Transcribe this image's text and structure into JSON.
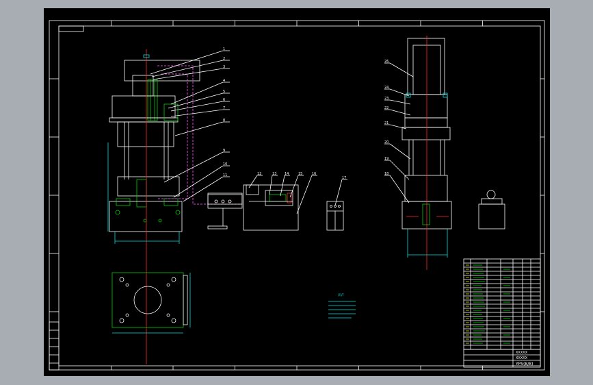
{
  "drawing": {
    "title_block": {
      "row_a": "XXXXX",
      "row_b": "XXXXX",
      "row_c": "YPS(8/8)"
    },
    "press_front_labels": [
      "1",
      "2",
      "3",
      "4",
      "5",
      "6",
      "7",
      "8",
      "9",
      "10",
      "11"
    ],
    "unit_labels": [
      "12",
      "13",
      "14",
      "15",
      "16",
      "17"
    ],
    "press_side_labels": [
      "26",
      "24",
      "23",
      "22",
      "21",
      "20",
      "19",
      "18"
    ],
    "tech_note_title": "/////",
    "colors": {
      "background": "#000000",
      "outline": "#ffffff",
      "part": "#00d000",
      "dimension": "#00e0e0",
      "centerline": "#ff2a2a",
      "hydraulic_line": "#e040e0"
    }
  }
}
